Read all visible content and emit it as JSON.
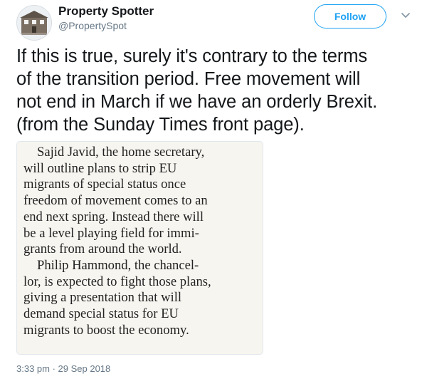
{
  "author": {
    "name": "Property Spotter",
    "handle": "@PropertySpot"
  },
  "actions": {
    "follow_label": "Follow"
  },
  "tweet": {
    "lines": [
      "If this is true, surely it's contrary to the terms",
      "of the transition period.  Free movement will",
      "not end in March if we have an orderly Brexit.",
      "(from the Sunday Times front page)."
    ]
  },
  "newspaper_clip": {
    "lines": [
      "Sajid Javid, the home secretary,",
      "will outline plans to strip EU",
      "migrants of special status once",
      "freedom of movement comes to an",
      "end next spring. Instead there will",
      "be a level playing field for immi-",
      "grants from around the world.",
      "Philip Hammond, the chancel-",
      "lor, is expected to fight those plans,",
      "giving a presentation that will",
      "demand special status for EU",
      "migrants to boost the economy."
    ]
  },
  "timestamp": "3:33 pm · 29 Sep 2018",
  "colors": {
    "accent": "#1da1f2",
    "text": "#14171a",
    "muted": "#657786"
  },
  "icons": {
    "avatar": "house-logo",
    "menu": "chevron-down-icon"
  }
}
